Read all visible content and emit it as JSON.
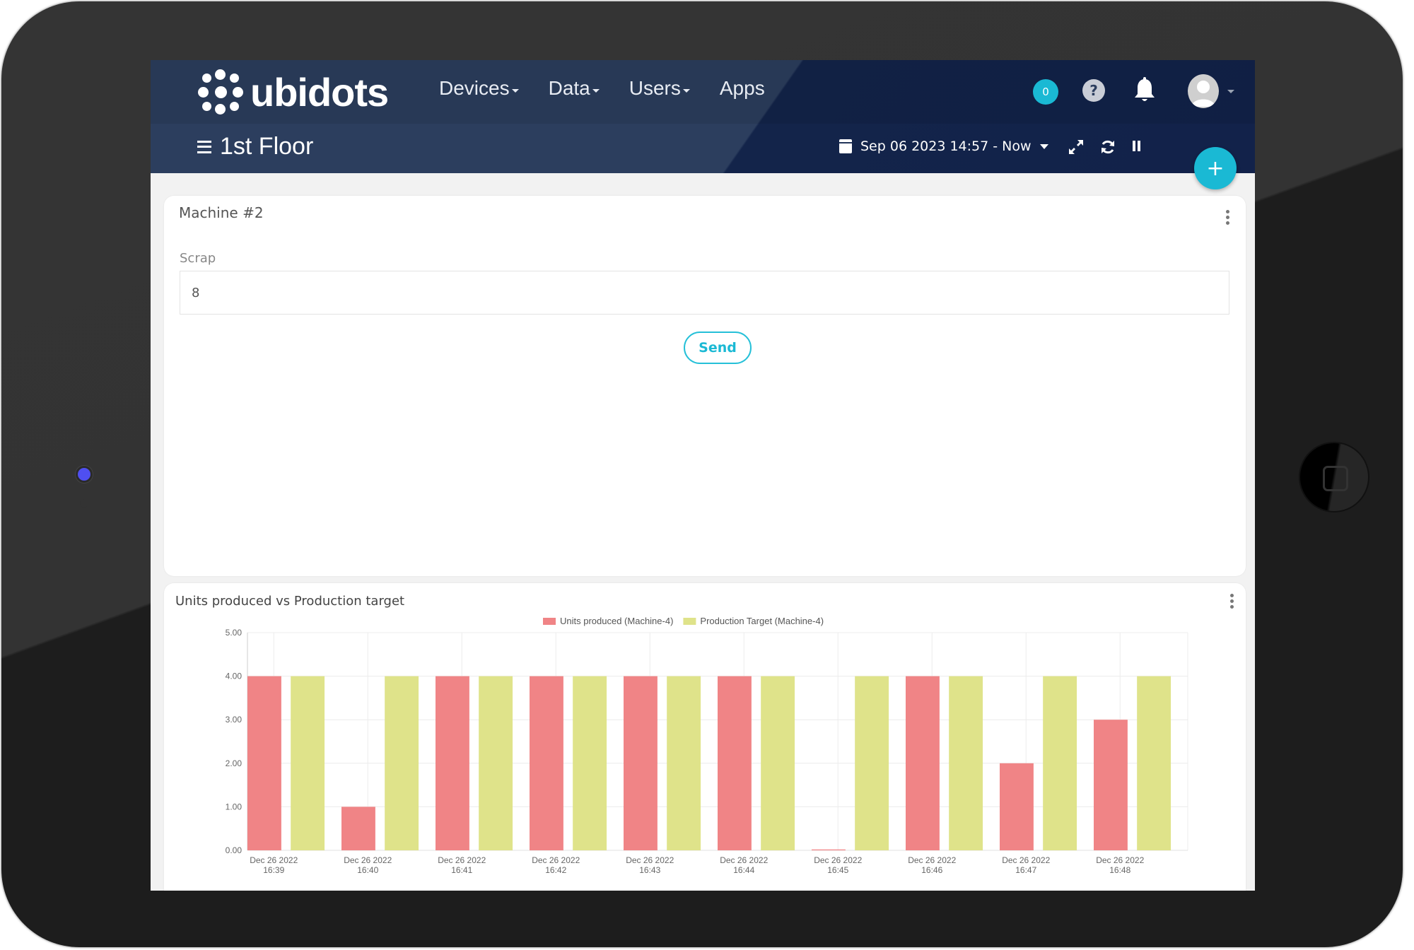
{
  "app": {
    "brand": "ubidots"
  },
  "nav": {
    "items": [
      {
        "label": "Devices",
        "has_dropdown": true
      },
      {
        "label": "Data",
        "has_dropdown": true
      },
      {
        "label": "Users",
        "has_dropdown": true
      },
      {
        "label": "Apps",
        "has_dropdown": false
      }
    ]
  },
  "header": {
    "notification_count": "0",
    "help_label": "?",
    "page_title": "1st Floor",
    "date_range": "Sep 06 2023 14:57 - Now",
    "icons": [
      "calendar-icon",
      "expand-icon",
      "refresh-icon",
      "pause-icon",
      "help-icon",
      "bell-icon",
      "avatar"
    ],
    "add_button_label": "+"
  },
  "colors": {
    "header_bg": "#2c3e5e",
    "accent": "#1ab9d4",
    "units_produced": "#f08486",
    "production_target": "#dfe38a"
  },
  "widget_input": {
    "title": "Machine #2",
    "field_label": "Scrap",
    "field_value": "8",
    "send_label": "Send"
  },
  "widget_chart": {
    "title": "Units produced vs Production target"
  },
  "chart_data": {
    "type": "bar",
    "title": "Units produced vs Production target",
    "categories": [
      [
        "Dec 26 2022",
        "16:39"
      ],
      [
        "Dec 26 2022",
        "16:40"
      ],
      [
        "Dec 26 2022",
        "16:41"
      ],
      [
        "Dec 26 2022",
        "16:42"
      ],
      [
        "Dec 26 2022",
        "16:43"
      ],
      [
        "Dec 26 2022",
        "16:44"
      ],
      [
        "Dec 26 2022",
        "16:45"
      ],
      [
        "Dec 26 2022",
        "16:46"
      ],
      [
        "Dec 26 2022",
        "16:47"
      ],
      [
        "Dec 26 2022",
        "16:48"
      ]
    ],
    "series": [
      {
        "name": "Units produced  (Machine-4)",
        "color": "#f08486",
        "values": [
          4,
          1,
          4,
          4,
          4,
          4,
          0.02,
          4,
          2,
          3
        ]
      },
      {
        "name": "Production Target  (Machine-4)",
        "color": "#dfe38a",
        "values": [
          4,
          4,
          4,
          4,
          4,
          4,
          4,
          4,
          4,
          4
        ]
      }
    ],
    "yticks": [
      "0.00",
      "1.00",
      "2.00",
      "3.00",
      "4.00",
      "5.00"
    ],
    "ylim": [
      0,
      5
    ],
    "xlabel": "",
    "ylabel": "",
    "grid": true,
    "legend": "top-center"
  }
}
